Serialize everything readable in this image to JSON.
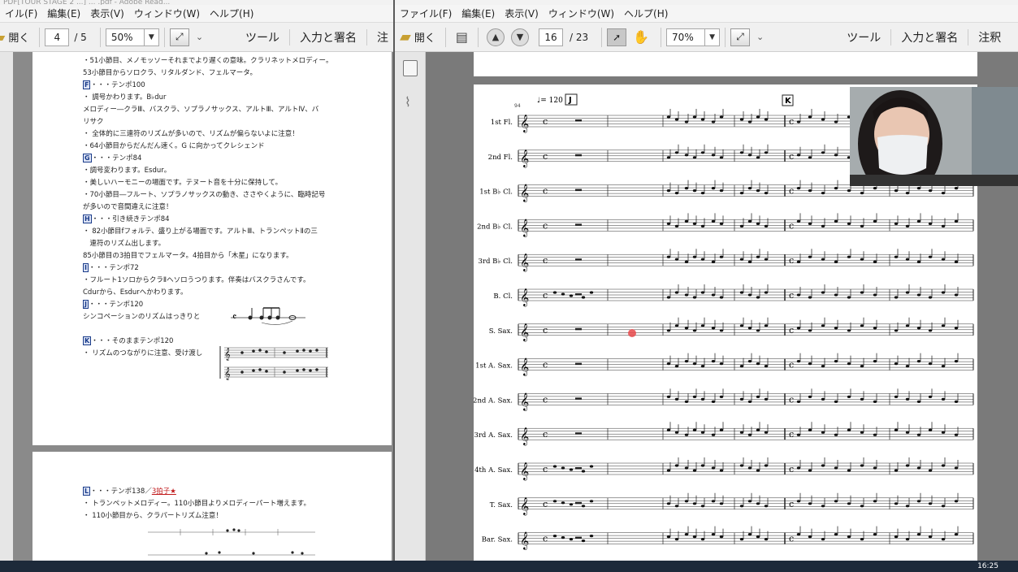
{
  "left_window": {
    "title": "PDF[TOUR STAGE 2 ...] ... .pdf - Adobe Read...",
    "menu": [
      "イル(F)",
      "編集(E)",
      "表示(V)",
      "ウィンドウ(W)",
      "ヘルプ(H)"
    ],
    "toolbar": {
      "open": "開く",
      "page_current": "4",
      "page_total": "/ 5",
      "zoom": "50%",
      "tools": "ツール",
      "sign": "入力と署名",
      "comment": "注"
    },
    "notes": [
      "・51小節目、メノモッソーそれまでより遅くの意味。クラリネットメロディー。",
      "53小節目からソロクラ、リタルダンド、フェルマータ。",
      {
        "mark": "F",
        "text": "・・・テンポ100"
      },
      "・ 調号かわります。B♭dur",
      "メロディー―クラⅢ、バスクラ、ソプラノサックス、アルトⅢ、アルトⅣ、バ",
      "リサク",
      "・ 全体的に三連符のリズムが多いので、リズムが偏らないよに注意！",
      "・64小節目からだんだん速く。G に向かってクレシェンド",
      {
        "mark": "G",
        "text": "・・・テンポ84"
      },
      "・調号変わります。Esdur。",
      "・美しいハーモニーの場面です。テヌート音を十分に保持して。",
      "・70小節目―フルート、ソプラノサックスの動き、ささやくように、臨時記号",
      "が多いので音間違えに注意！",
      {
        "mark": "H",
        "text": "・・・引き続きテンポ84"
      },
      "・ 82小節目fフォルテ、盛り上がる場面です。アルトⅢ、トランペットⅡの三",
      "　連符のリズム出します。",
      "85小節目の3拍目でフェルマータ。4拍目から「木星」になります。",
      {
        "mark": "I",
        "text": "・・・テンポ72"
      },
      "・フルート1ソロからクラⅡヘソロうつります。伴奏はバスクラさんです。",
      "Cdurから、Esdurへかわります。",
      {
        "mark": "J",
        "text": "・・・テンポ120"
      },
      "シンコペーションのリズムはっきりと",
      "",
      {
        "mark": "K",
        "text": "・・・そのままテンポ120"
      },
      "・ リズムのつながりに注意、受け渡し"
    ],
    "page2": {
      "mark": "L",
      "tempo": "・・・テンポ138／",
      "tempo_red": "3拍子★",
      "line1": "・ トランペットメロディー。110小節目よりメロディーパート増えます。",
      "line2": "・ 110小節目から、クラパートリズム注意！"
    }
  },
  "right_window": {
    "menu": [
      "ファイル(F)",
      "編集(E)",
      "表示(V)",
      "ウィンドウ(W)",
      "ヘルプ(H)"
    ],
    "toolbar": {
      "open": "開く",
      "page_current": "16",
      "page_total": "/ 23",
      "zoom": "70%",
      "tools": "ツール",
      "sign": "入力と署名",
      "comment": "注釈"
    },
    "score": {
      "tempo": "♩= 120",
      "measure_number": "94",
      "rehearsal_j": "J",
      "rehearsal_k": "K",
      "instruments": [
        "1st Fl.",
        "2nd Fl.",
        "1st B♭ Cl.",
        "2nd B♭ Cl.",
        "3rd B♭ Cl.",
        "B. Cl.",
        "S. Sax.",
        "1st A. Sax.",
        "2nd A. Sax.",
        "3rd A. Sax.",
        "4th A. Sax.",
        "T. Sax.",
        "Bar. Sax."
      ]
    }
  },
  "taskbar": {
    "clock": "16:25"
  },
  "colors": {
    "accent_red": "#c0181a",
    "mark_blue": "#1a3c8a",
    "taskbar": "#1d2a3a"
  }
}
